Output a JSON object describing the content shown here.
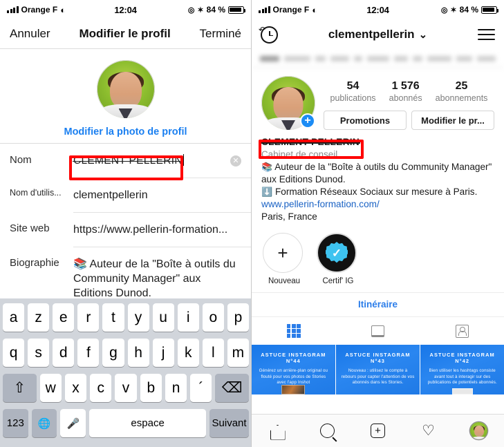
{
  "status_bar": {
    "carrier": "Orange F",
    "time": "12:04",
    "battery": "84 %",
    "icons": [
      "signal-bars-icon",
      "wifi-icon",
      "location-icon",
      "bluetooth-icon",
      "battery-icon"
    ]
  },
  "left_panel": {
    "navbar": {
      "cancel": "Annuler",
      "title": "Modifier le profil",
      "done": "Terminé"
    },
    "avatar": {
      "change_photo_label": "Modifier la photo de profil"
    },
    "fields": [
      {
        "label": "Nom",
        "value": "CLEMENT PELLERIN",
        "highlighted": true,
        "has_clear": true
      },
      {
        "label": "Nom d'utilis...",
        "value": "clementpellerin",
        "highlighted": false,
        "has_clear": false
      },
      {
        "label": "Site web",
        "value": "https://www.pellerin-formation...",
        "highlighted": false,
        "has_clear": false
      },
      {
        "label": "Biographie",
        "value": "📚 Auteur de la \"Boîte à outils du Community Manager\" aux Editions Dunod.",
        "value2": "📘 Formation Réseaux Sociaux",
        "highlighted": false,
        "has_clear": false
      }
    ],
    "keyboard": {
      "row1": [
        "a",
        "z",
        "e",
        "r",
        "t",
        "y",
        "u",
        "i",
        "o",
        "p"
      ],
      "row2": [
        "q",
        "s",
        "d",
        "f",
        "g",
        "h",
        "j",
        "k",
        "l",
        "m"
      ],
      "row3": [
        "w",
        "x",
        "c",
        "v",
        "b",
        "n",
        "´"
      ],
      "shift": "⇧",
      "backspace": "⌫",
      "numbers": "123",
      "globe": "🌐",
      "mic": "mic-icon",
      "space": "espace",
      "next": "Suivant"
    }
  },
  "right_panel": {
    "navbar": {
      "history_icon": "history-icon",
      "username": "clementpellerin",
      "chevron": "⌄",
      "menu_icon": "hamburger-menu-icon"
    },
    "stats": [
      {
        "value": "54",
        "label": "publications"
      },
      {
        "value": "1 576",
        "label": "abonnés"
      },
      {
        "value": "25",
        "label": "abonnements"
      }
    ],
    "buttons": {
      "promotions": "Promotions",
      "edit_profile": "Modifier le pr..."
    },
    "bio": {
      "name": "CLEMENT PELLERIN",
      "subtitle": "Cabinet de conseil",
      "line1": "Auteur de la \"Boîte à outils du Community Manager\" aux Editions Dunod.",
      "line2": "Formation Réseaux Sociaux sur mesure à Paris.",
      "website": "www.pellerin-formation.com/",
      "location": "Paris, France"
    },
    "highlights": [
      {
        "label": "Nouveau",
        "icon": "plus-icon"
      },
      {
        "label": "Certif' IG",
        "icon": "verified-badge-icon"
      }
    ],
    "itineraire": "Itinéraire",
    "tabs": [
      {
        "name": "grid-tab",
        "icon": "grid-icon",
        "active": true
      },
      {
        "name": "list-tab",
        "icon": "list-icon",
        "active": false
      },
      {
        "name": "tagged-tab",
        "icon": "tagged-person-icon",
        "active": false
      }
    ],
    "posts": [
      {
        "title": "ASTUCE INSTAGRAM N°44",
        "body": "Générez un arrière-plan original ou flouté pour vos photos de Stories avec l'app Inshot"
      },
      {
        "title": "ASTUCE INSTAGRAM N°43",
        "body": "Nouveau : utilisez le compte à rebours pour capter l'attention de vos abonnés dans les Stories."
      },
      {
        "title": "ASTUCE INSTAGRAM N°42",
        "body": "Bien utiliser les hashtags consiste avant tout à interagir sur des publications de potentiels abonnés."
      }
    ],
    "tabbar": [
      "home-icon",
      "search-icon",
      "add-post-icon",
      "heart-icon",
      "profile-avatar-icon"
    ]
  },
  "colors": {
    "accent_blue": "#1a7ff0",
    "link_blue": "#1a62c4",
    "highlight_red": "#ff0000",
    "post_blue": "#1877e8"
  }
}
